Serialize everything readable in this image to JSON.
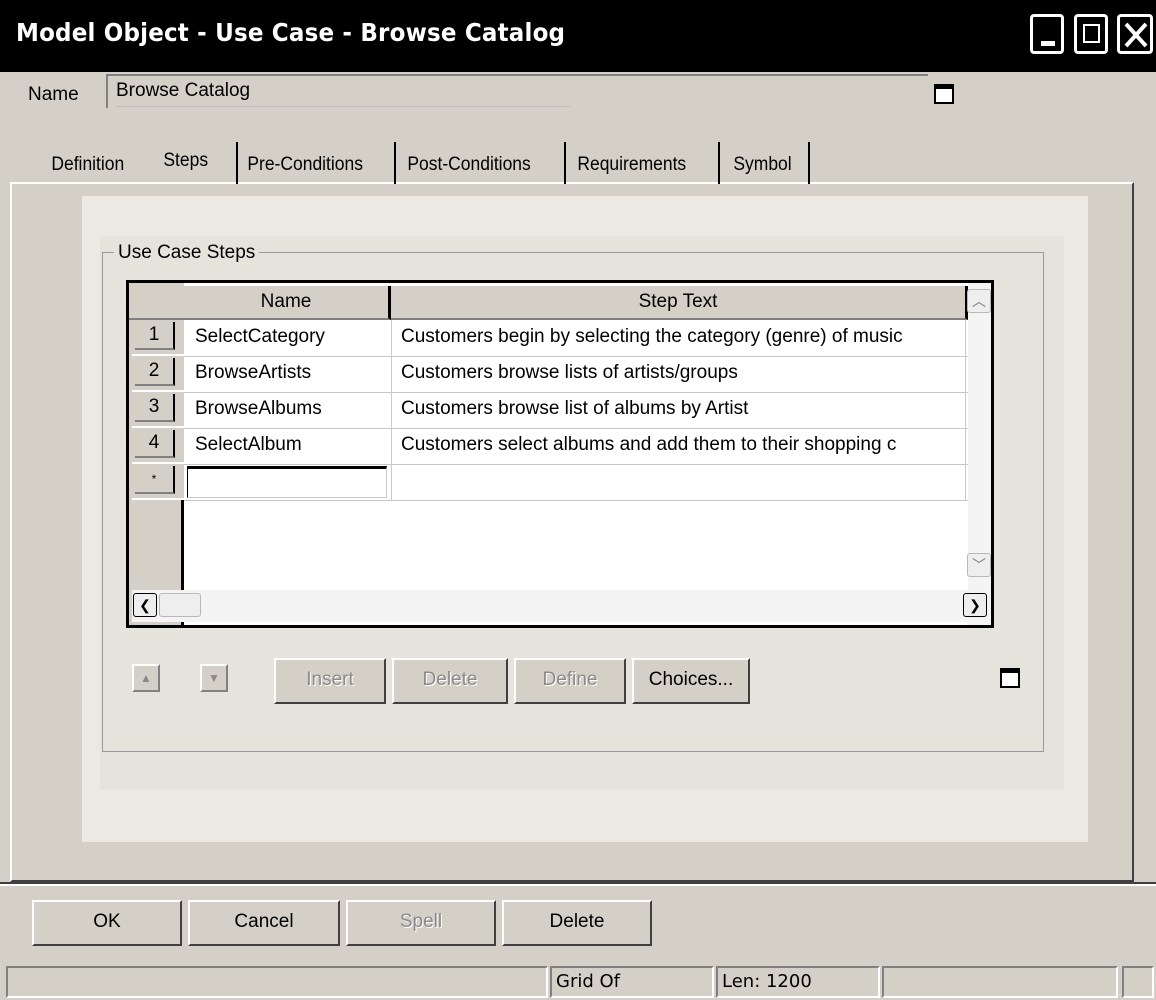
{
  "window": {
    "title": "Model Object - Use Case - Browse Catalog"
  },
  "name_field": {
    "label": "Name",
    "value": "Browse Catalog"
  },
  "tabs": [
    {
      "label": "Definition"
    },
    {
      "label": "Steps",
      "selected": true
    },
    {
      "label": "Pre-Conditions"
    },
    {
      "label": "Post-Conditions"
    },
    {
      "label": "Requirements"
    },
    {
      "label": "Symbol"
    }
  ],
  "steps_group": {
    "title": "Use Case Steps",
    "columns": [
      "Name",
      "Step Text"
    ],
    "rows": [
      {
        "num": "1",
        "name": "SelectCategory",
        "text": "Customers begin by selecting the category (genre) of music"
      },
      {
        "num": "2",
        "name": "BrowseArtists",
        "text": "Customers browse lists of artists/groups"
      },
      {
        "num": "3",
        "name": "BrowseAlbums",
        "text": "Customers browse list of albums by Artist"
      },
      {
        "num": "4",
        "name": "SelectAlbum",
        "text": "Customers select albums and add them to their shopping c"
      }
    ],
    "new_row_marker": "*",
    "new_row_name": ""
  },
  "grid_buttons": {
    "insert": "Insert",
    "delete": "Delete",
    "define": "Define",
    "choices": "Choices..."
  },
  "dialog_buttons": {
    "ok": "OK",
    "cancel": "Cancel",
    "spell": "Spell",
    "delete": "Delete"
  },
  "status_bar": {
    "grid": "Grid Of",
    "length": "Len: 1200"
  },
  "icons": {
    "minimize": "minimize-icon",
    "maximize": "maximize-icon",
    "close": "close-icon",
    "scroll_up": "chevron-up-icon",
    "scroll_down": "chevron-down-icon",
    "scroll_left": "chevron-left-icon",
    "scroll_right": "chevron-right-icon",
    "move_up": "triangle-up-icon",
    "move_down": "triangle-down-icon"
  },
  "colors": {
    "title_bar": "#000000",
    "dialog_face": "#d4d0c8",
    "disabled_text": "#8a8a8a"
  }
}
